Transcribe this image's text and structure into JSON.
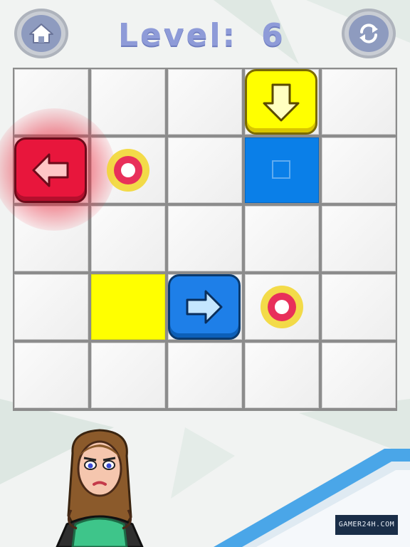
{
  "header": {
    "level_label": "Level:",
    "level_number": "6",
    "home_icon": "home-icon",
    "refresh_icon": "refresh-icon"
  },
  "board": {
    "rows": 5,
    "cols": 5,
    "colors": {
      "red": "#e8163c",
      "yellow": "#ffff00",
      "blue": "#1e7fe8",
      "target_ring": "#f2d62a",
      "target_inner": "#e8305a"
    },
    "pieces": [
      {
        "type": "arrow-tile",
        "color": "yellow",
        "direction": "down",
        "row": 1,
        "col": 4
      },
      {
        "type": "arrow-tile",
        "color": "red",
        "direction": "left",
        "row": 2,
        "col": 1,
        "selected": true
      },
      {
        "type": "arrow-tile",
        "color": "blue",
        "direction": "right",
        "row": 4,
        "col": 3
      },
      {
        "type": "target",
        "row": 2,
        "col": 2
      },
      {
        "type": "target",
        "row": 4,
        "col": 4
      },
      {
        "type": "goal-cell",
        "color": "blue",
        "row": 2,
        "col": 4
      },
      {
        "type": "goal-cell",
        "color": "yellow",
        "row": 4,
        "col": 2
      }
    ]
  },
  "watermark": "GAMER24H.COM"
}
